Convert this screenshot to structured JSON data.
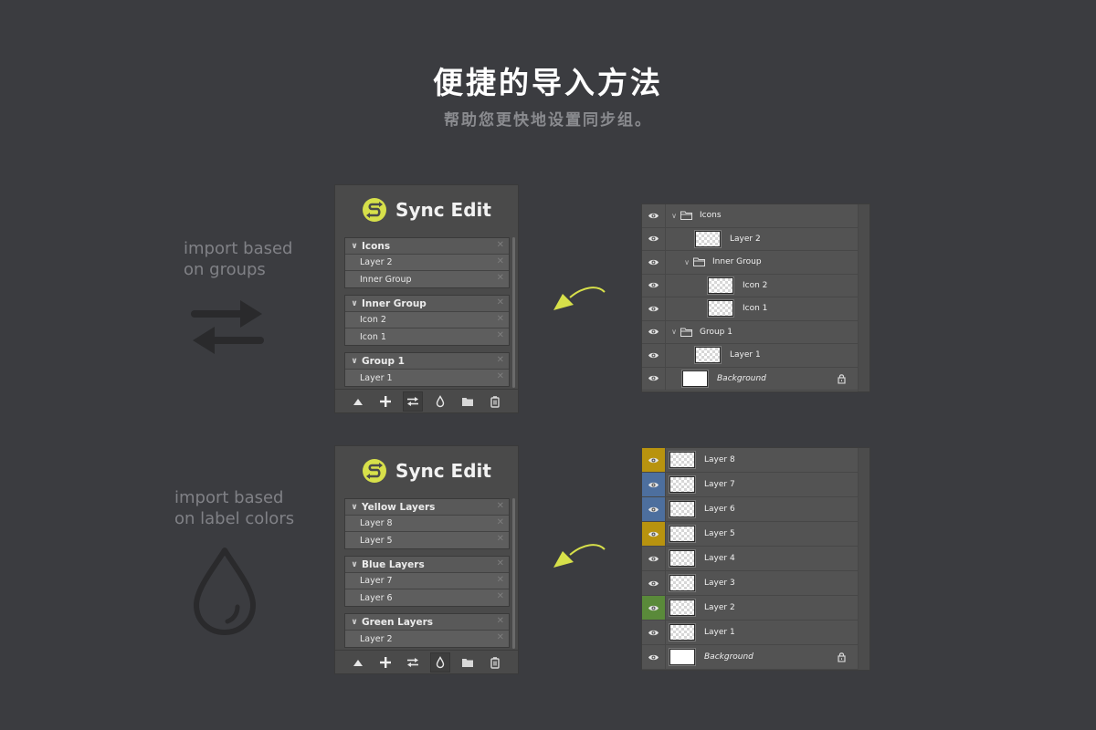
{
  "hero": {
    "title": "便捷的导入方法",
    "subtitle": "帮助您更快地设置同步组。"
  },
  "colors": {
    "background": "#3b3c40",
    "accent_yellow": "#d7e04a",
    "label_yellow": "#b8930f",
    "label_blue": "#4d6f9e",
    "label_green": "#5a8a3a"
  },
  "sections": [
    {
      "caption_line1": "import based",
      "caption_line2": "on groups",
      "icon": "swap-arrows-icon",
      "sync_panel": {
        "title": "Sync Edit",
        "groups": [
          {
            "name": "Icons",
            "items": [
              "Layer 2",
              "Inner Group"
            ]
          },
          {
            "name": "Inner Group",
            "items": [
              "Icon 2",
              "Icon 1"
            ]
          },
          {
            "name": "Group 1",
            "items": [
              "Layer 1"
            ]
          }
        ],
        "active_tool": "import-groups"
      },
      "layers_panel": {
        "layers": [
          {
            "name": "Icons",
            "type": "group",
            "indent": 0
          },
          {
            "name": "Layer 2",
            "type": "layer",
            "indent": 1
          },
          {
            "name": "Inner Group",
            "type": "group",
            "indent": 1
          },
          {
            "name": "Icon 2",
            "type": "layer",
            "indent": 2
          },
          {
            "name": "Icon 1",
            "type": "layer",
            "indent": 2
          },
          {
            "name": "Group 1",
            "type": "group",
            "indent": 0
          },
          {
            "name": "Layer 1",
            "type": "layer",
            "indent": 1
          },
          {
            "name": "Background",
            "type": "background",
            "indent": 0,
            "locked": true
          }
        ]
      }
    },
    {
      "caption_line1": "import based",
      "caption_line2": "on label colors",
      "icon": "drop-icon",
      "sync_panel": {
        "title": "Sync Edit",
        "groups": [
          {
            "name": "Yellow Layers",
            "items": [
              "Layer 8",
              "Layer 5"
            ]
          },
          {
            "name": "Blue Layers",
            "items": [
              "Layer 7",
              "Layer 6"
            ]
          },
          {
            "name": "Green Layers",
            "items": [
              "Layer 2"
            ]
          }
        ],
        "active_tool": "import-colors"
      },
      "layers_panel": {
        "layers": [
          {
            "name": "Layer 8",
            "label": "yellow"
          },
          {
            "name": "Layer 7",
            "label": "blue"
          },
          {
            "name": "Layer 6",
            "label": "blue"
          },
          {
            "name": "Layer 5",
            "label": "yellow"
          },
          {
            "name": "Layer 4",
            "label": "none"
          },
          {
            "name": "Layer 3",
            "label": "none"
          },
          {
            "name": "Layer 2",
            "label": "green"
          },
          {
            "name": "Layer 1",
            "label": "none"
          },
          {
            "name": "Background",
            "label": "none",
            "locked": true
          }
        ]
      }
    }
  ],
  "toolbar": {
    "buttons": [
      {
        "id": "move-up",
        "icon": "triangle-up-icon"
      },
      {
        "id": "add",
        "icon": "plus-icon"
      },
      {
        "id": "import-groups",
        "icon": "swap-arrows-icon"
      },
      {
        "id": "import-colors",
        "icon": "drop-icon"
      },
      {
        "id": "folder",
        "icon": "folder-icon"
      },
      {
        "id": "delete",
        "icon": "trash-icon"
      }
    ]
  }
}
